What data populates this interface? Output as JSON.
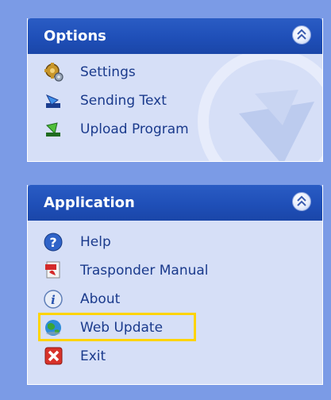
{
  "options_panel": {
    "title": "Options",
    "items": [
      {
        "label": "Settings",
        "icon": "settings-gear-icon"
      },
      {
        "label": "Sending Text",
        "icon": "send-arrow-icon"
      },
      {
        "label": "Upload Program",
        "icon": "upload-arrow-icon"
      }
    ]
  },
  "application_panel": {
    "title": "Application",
    "items": [
      {
        "label": "Help",
        "icon": "help-icon"
      },
      {
        "label": "Trasponder Manual",
        "icon": "pdf-manual-icon"
      },
      {
        "label": "About",
        "icon": "info-icon"
      },
      {
        "label": "Web Update",
        "icon": "globe-icon"
      },
      {
        "label": "Exit",
        "icon": "exit-x-icon"
      }
    ]
  },
  "highlight_color": "#ffd400",
  "header_color": "#1f4fb8",
  "body_color": "#d6dff7",
  "background_color": "#7b9be6"
}
